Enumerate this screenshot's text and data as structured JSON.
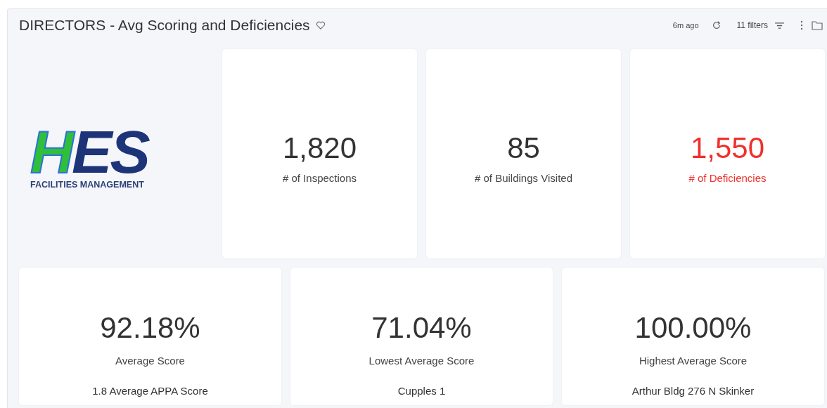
{
  "header": {
    "title": "DIRECTORS - Avg Scoring and Deficiencies",
    "updated": "6m ago",
    "filters": "11 filters"
  },
  "logo": {
    "parts": [
      "H",
      "ES"
    ],
    "subtitle": "FACILITIES MANAGEMENT"
  },
  "top_metrics": [
    {
      "value": "1,820",
      "label": "# of Inspections",
      "alert": false
    },
    {
      "value": "85",
      "label": "# of Buildings Visited",
      "alert": false
    },
    {
      "value": "1,550",
      "label": "# of Deficiencies",
      "alert": true
    }
  ],
  "bottom_metrics": [
    {
      "value": "92.18%",
      "label": "Average Score",
      "detail": "1.8 Average APPA Score"
    },
    {
      "value": "71.04%",
      "label": "Lowest Average Score",
      "detail": "Cupples 1"
    },
    {
      "value": "100.00%",
      "label": "Highest Average Score",
      "detail": "Arthur Bldg 276 N Skinker"
    }
  ]
}
